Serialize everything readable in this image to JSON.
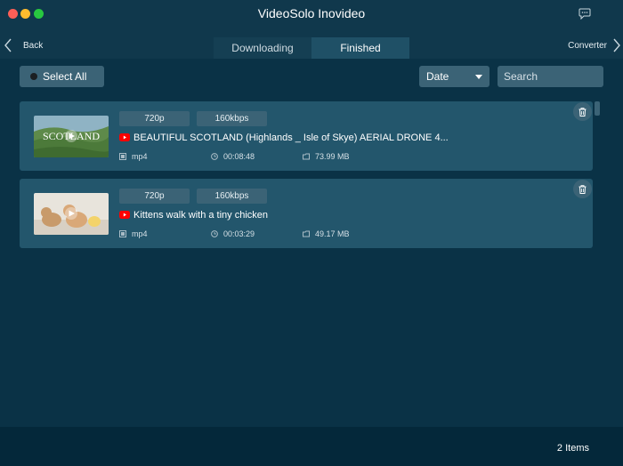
{
  "window": {
    "title": "VideoSolo Inovideo"
  },
  "nav": {
    "back_label": "Back",
    "forward_label": "Converter"
  },
  "tabs": [
    {
      "label": "Downloading",
      "active": false
    },
    {
      "label": "Finished",
      "active": true
    }
  ],
  "toolbar": {
    "select_all_label": "Select All",
    "sort_value": "Date",
    "search_placeholder": "Search"
  },
  "items": [
    {
      "resolution": "720p",
      "bitrate": "160kbps",
      "title": "BEAUTIFUL SCOTLAND (Highlands _ Isle of Skye) AERIAL DRONE 4...",
      "format": "mp4",
      "duration": "00:08:48",
      "size": "73.99 MB",
      "thumb_text": "SCOTLAND",
      "source_icon": "youtube-icon"
    },
    {
      "resolution": "720p",
      "bitrate": "160kbps",
      "title": "Kittens walk with a tiny chicken",
      "format": "mp4",
      "duration": "00:03:29",
      "size": "49.17 MB",
      "source_icon": "youtube-icon"
    }
  ],
  "footer": {
    "count": "2 Items"
  },
  "colors": {
    "background": "#0a3246",
    "card": "#23566c",
    "control": "#3b6376",
    "youtube_red": "#ff0000"
  }
}
